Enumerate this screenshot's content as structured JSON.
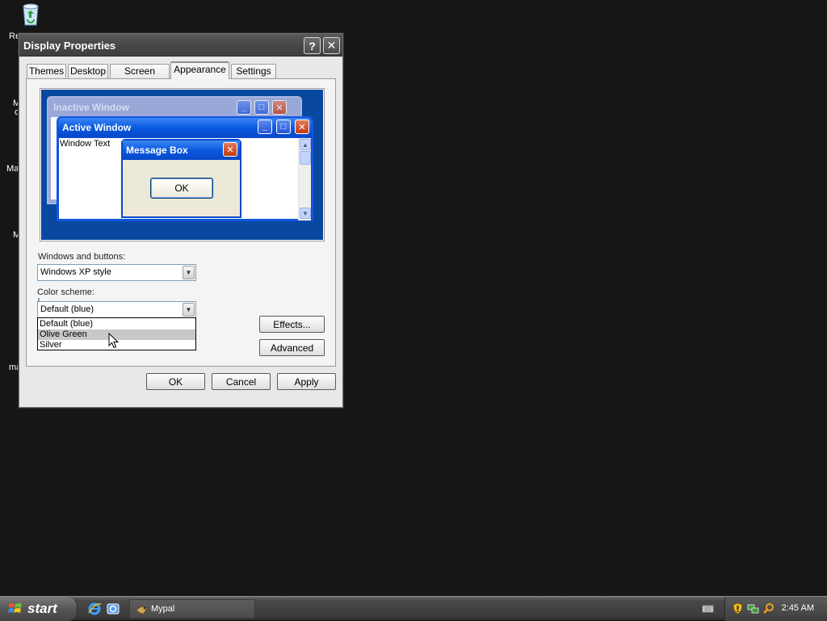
{
  "desktop": {
    "labels": [
      "Re",
      "M",
      "c",
      "Ma",
      "M",
      "ma"
    ]
  },
  "dialog": {
    "title": "Display Properties",
    "help_label": "?",
    "close_label": "✕",
    "tabs": [
      {
        "label": "Themes"
      },
      {
        "label": "Desktop"
      },
      {
        "label": "Screen Saver"
      },
      {
        "label": "Appearance",
        "active": true
      },
      {
        "label": "Settings"
      }
    ],
    "preview": {
      "inactive_window": "Inactive Window",
      "active_window": "Active Window",
      "window_text": "Window Text",
      "message_box": "Message Box",
      "message_ok": "OK",
      "minimize_glyph": "_",
      "maximize_glyph": "□",
      "close_glyph": "✕"
    },
    "windows_buttons": {
      "label": "Windows and buttons:",
      "value": "Windows XP style"
    },
    "color_scheme": {
      "label": "Color scheme:",
      "value": "Default (blue)",
      "options": [
        "Default (blue)",
        "Olive Green",
        "Silver"
      ],
      "hovered": "Olive Green"
    },
    "effects_label": "Effects...",
    "advanced_label": "Advanced",
    "ok_label": "OK",
    "cancel_label": "Cancel",
    "apply_label": "Apply"
  },
  "taskbar": {
    "start_label": "start",
    "task_label": "Mypal",
    "clock": "2:45 AM"
  },
  "colors": {
    "desktop_bg": "#161616",
    "preview_bg": "#0848a0",
    "active_title": "#0a5ae0",
    "close_red": "#c23a14"
  }
}
